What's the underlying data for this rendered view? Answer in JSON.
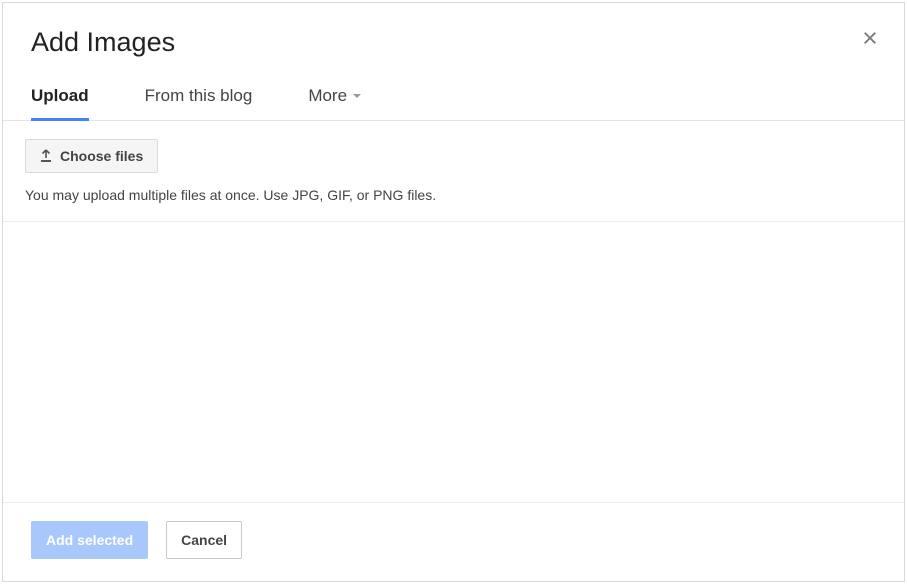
{
  "dialog": {
    "title": "Add Images"
  },
  "tabs": {
    "upload": "Upload",
    "from_blog": "From this blog",
    "more": "More"
  },
  "upload": {
    "choose_files_label": "Choose files",
    "hint": "You may upload multiple files at once. Use JPG, GIF, or PNG files."
  },
  "footer": {
    "add_selected_label": "Add selected",
    "cancel_label": "Cancel"
  }
}
